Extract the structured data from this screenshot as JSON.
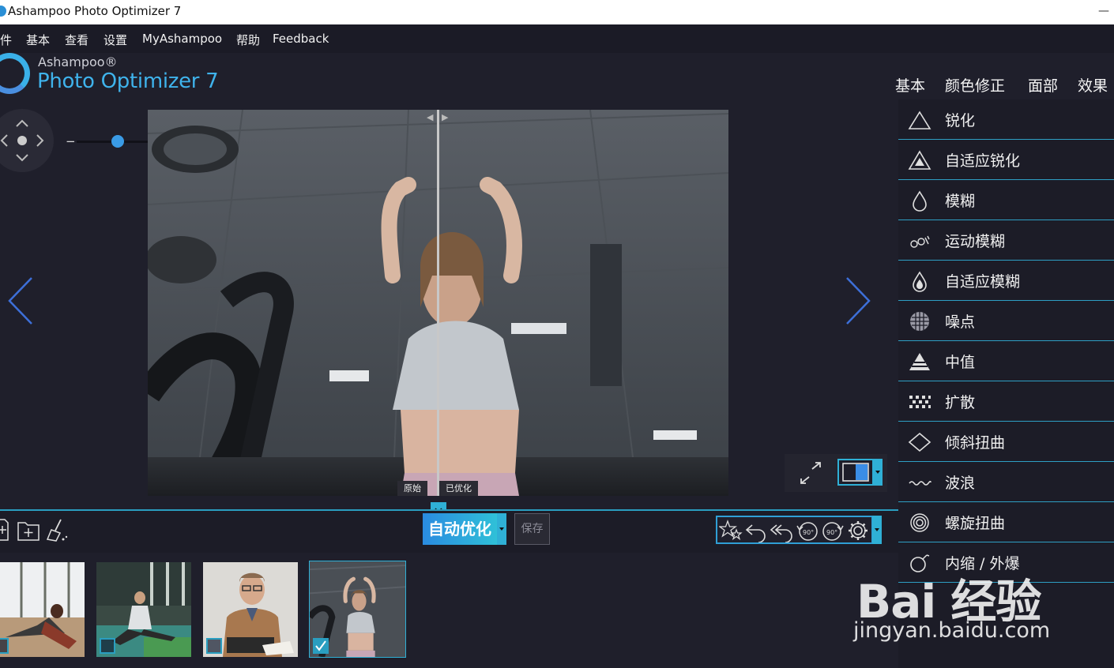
{
  "window": {
    "title": "Ashampoo Photo Optimizer 7"
  },
  "menu": [
    "件",
    "基本",
    "查看",
    "设置",
    "MyAshampoo",
    "帮助",
    "Feedback"
  ],
  "logo": {
    "brand": "Ashampoo®",
    "product": "Photo Optimizer 7"
  },
  "category_tabs": [
    "基本",
    "颜色修正",
    "面部",
    "效果"
  ],
  "effects": [
    {
      "label": "锐化",
      "icon": "triangle-outline-icon"
    },
    {
      "label": "自适应锐化",
      "icon": "triangle-adaptive-icon"
    },
    {
      "label": "模糊",
      "icon": "drop-outline-icon"
    },
    {
      "label": "运动模糊",
      "icon": "motion-drops-icon"
    },
    {
      "label": "自适应模糊",
      "icon": "drop-filled-icon"
    },
    {
      "label": "噪点",
      "icon": "noise-sphere-icon"
    },
    {
      "label": "中值",
      "icon": "median-triangle-icon"
    },
    {
      "label": "扩散",
      "icon": "diffuse-dots-icon"
    },
    {
      "label": "倾斜扭曲",
      "icon": "diamond-icon"
    },
    {
      "label": "波浪",
      "icon": "wave-icon"
    },
    {
      "label": "螺旋扭曲",
      "icon": "spiral-icon"
    },
    {
      "label": "内缩 / 外爆",
      "icon": "bomb-icon"
    }
  ],
  "zoom": {
    "minus": "−",
    "plus": "+",
    "level": 0.4
  },
  "compare": {
    "original": "原始",
    "optimized": "已优化"
  },
  "actions": {
    "auto_optimize": "自动优化",
    "save": "保存"
  },
  "rotate": {
    "left": "90°",
    "right": "90°"
  },
  "thumbnails": [
    {
      "name": "yoga-pair",
      "checked": false
    },
    {
      "name": "gym-stretch",
      "checked": false
    },
    {
      "name": "man-typewriter",
      "checked": false
    },
    {
      "name": "woman-gym",
      "checked": true,
      "selected": true
    }
  ],
  "watermark": {
    "logo": "Bai 经验",
    "site": "jingyan.baidu.com"
  },
  "colors": {
    "accent": "#2fb0d6",
    "panel": "#1c1c27",
    "background": "#1f1f2b"
  }
}
